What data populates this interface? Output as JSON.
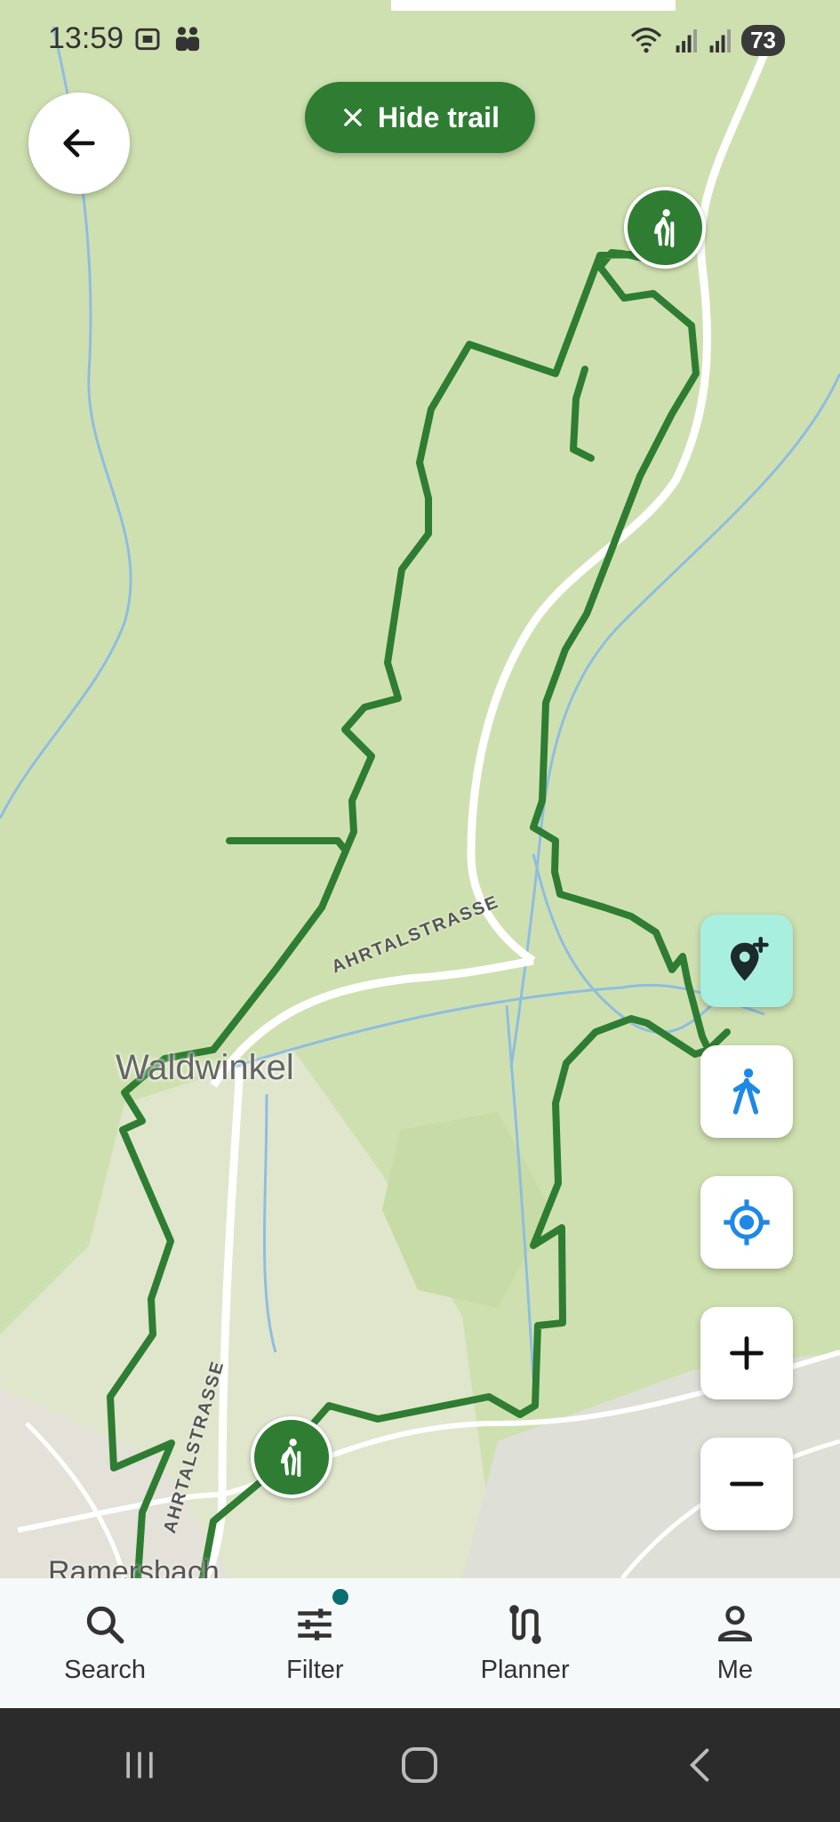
{
  "status_bar": {
    "time": "13:59",
    "battery": "73",
    "icons": [
      "screenshot-icon",
      "people-icon",
      "wifi-icon",
      "signal-icon",
      "signal-icon",
      "battery-icon"
    ]
  },
  "top": {
    "back_icon": "arrow-left-icon",
    "hide_trail_label": "Hide trail",
    "hide_trail_icon": "close-icon"
  },
  "map": {
    "labels": {
      "road_main": "AHRTALSTRASSE",
      "road_lower": "AHRTALSTRASSE",
      "village_1": "Waldwinkel",
      "village_2": "Ramersbach"
    },
    "colors": {
      "background": "#cfe0b0",
      "trail": "#2e7d32",
      "water": "#8fbde0",
      "road": "#ffffff"
    },
    "controls": [
      "add-location-icon",
      "walking-icon",
      "my-location-icon",
      "zoom-in-icon",
      "zoom-out-icon"
    ]
  },
  "bottom_nav": {
    "items": [
      {
        "label": "Search",
        "icon": "search-icon"
      },
      {
        "label": "Filter",
        "icon": "filter-icon",
        "badge": true
      },
      {
        "label": "Planner",
        "icon": "route-icon"
      },
      {
        "label": "Me",
        "icon": "person-icon"
      }
    ]
  },
  "system_nav": {
    "icons": [
      "recents-icon",
      "home-icon",
      "back-icon"
    ]
  }
}
